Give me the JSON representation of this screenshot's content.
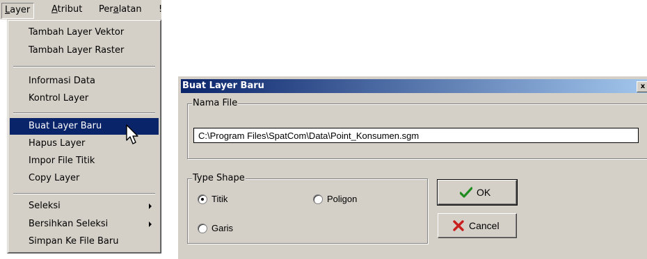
{
  "menubar": {
    "items": [
      {
        "label": "Layer",
        "first": "L",
        "rest": "ayer"
      },
      {
        "label": "Atribut",
        "first": "A",
        "rest": "tribut"
      },
      {
        "label": "Peralatan",
        "pre": "Per",
        "mid": "a",
        "post": "latan"
      }
    ],
    "partial": "!"
  },
  "menu": {
    "items": [
      {
        "label": "Tambah Layer Vektor"
      },
      {
        "label": "Tambah Layer Raster"
      },
      {
        "label": "Informasi Data"
      },
      {
        "label": "Kontrol Layer"
      },
      {
        "label": "Buat Layer Baru",
        "selected": true
      },
      {
        "label": "Hapus Layer"
      },
      {
        "label": "Impor File Titik"
      },
      {
        "label": "Copy Layer"
      },
      {
        "label": "Seleksi",
        "submenu": true
      },
      {
        "label": "Bersihkan Seleksi",
        "submenu": true
      },
      {
        "label": "Simpan Ke File Baru"
      }
    ]
  },
  "dialog": {
    "title": "Buat Layer Baru",
    "close_label": "x",
    "file_group_label": "Nama File",
    "file_path": "C:\\Program Files\\SpatCom\\Data\\Point_Konsumen.sgm",
    "shape_group_label": "Type Shape",
    "options": [
      {
        "label": "Titik",
        "checked": true
      },
      {
        "label": "Poligon",
        "checked": false
      },
      {
        "label": "Garis",
        "checked": false
      }
    ],
    "ok_label": "OK",
    "cancel_label": "Cancel"
  },
  "colors": {
    "face": "#d4d0c8",
    "title_start": "#0a246a",
    "title_end": "#a6caf0",
    "selection": "#0a246a",
    "ok_icon": "#1e8c1e",
    "cancel_icon": "#c81e1e"
  },
  "icons": {
    "ok": "check-icon",
    "cancel": "x-icon",
    "pointer": "mouse-pointer-icon",
    "submenu": "triangle-right-icon"
  }
}
